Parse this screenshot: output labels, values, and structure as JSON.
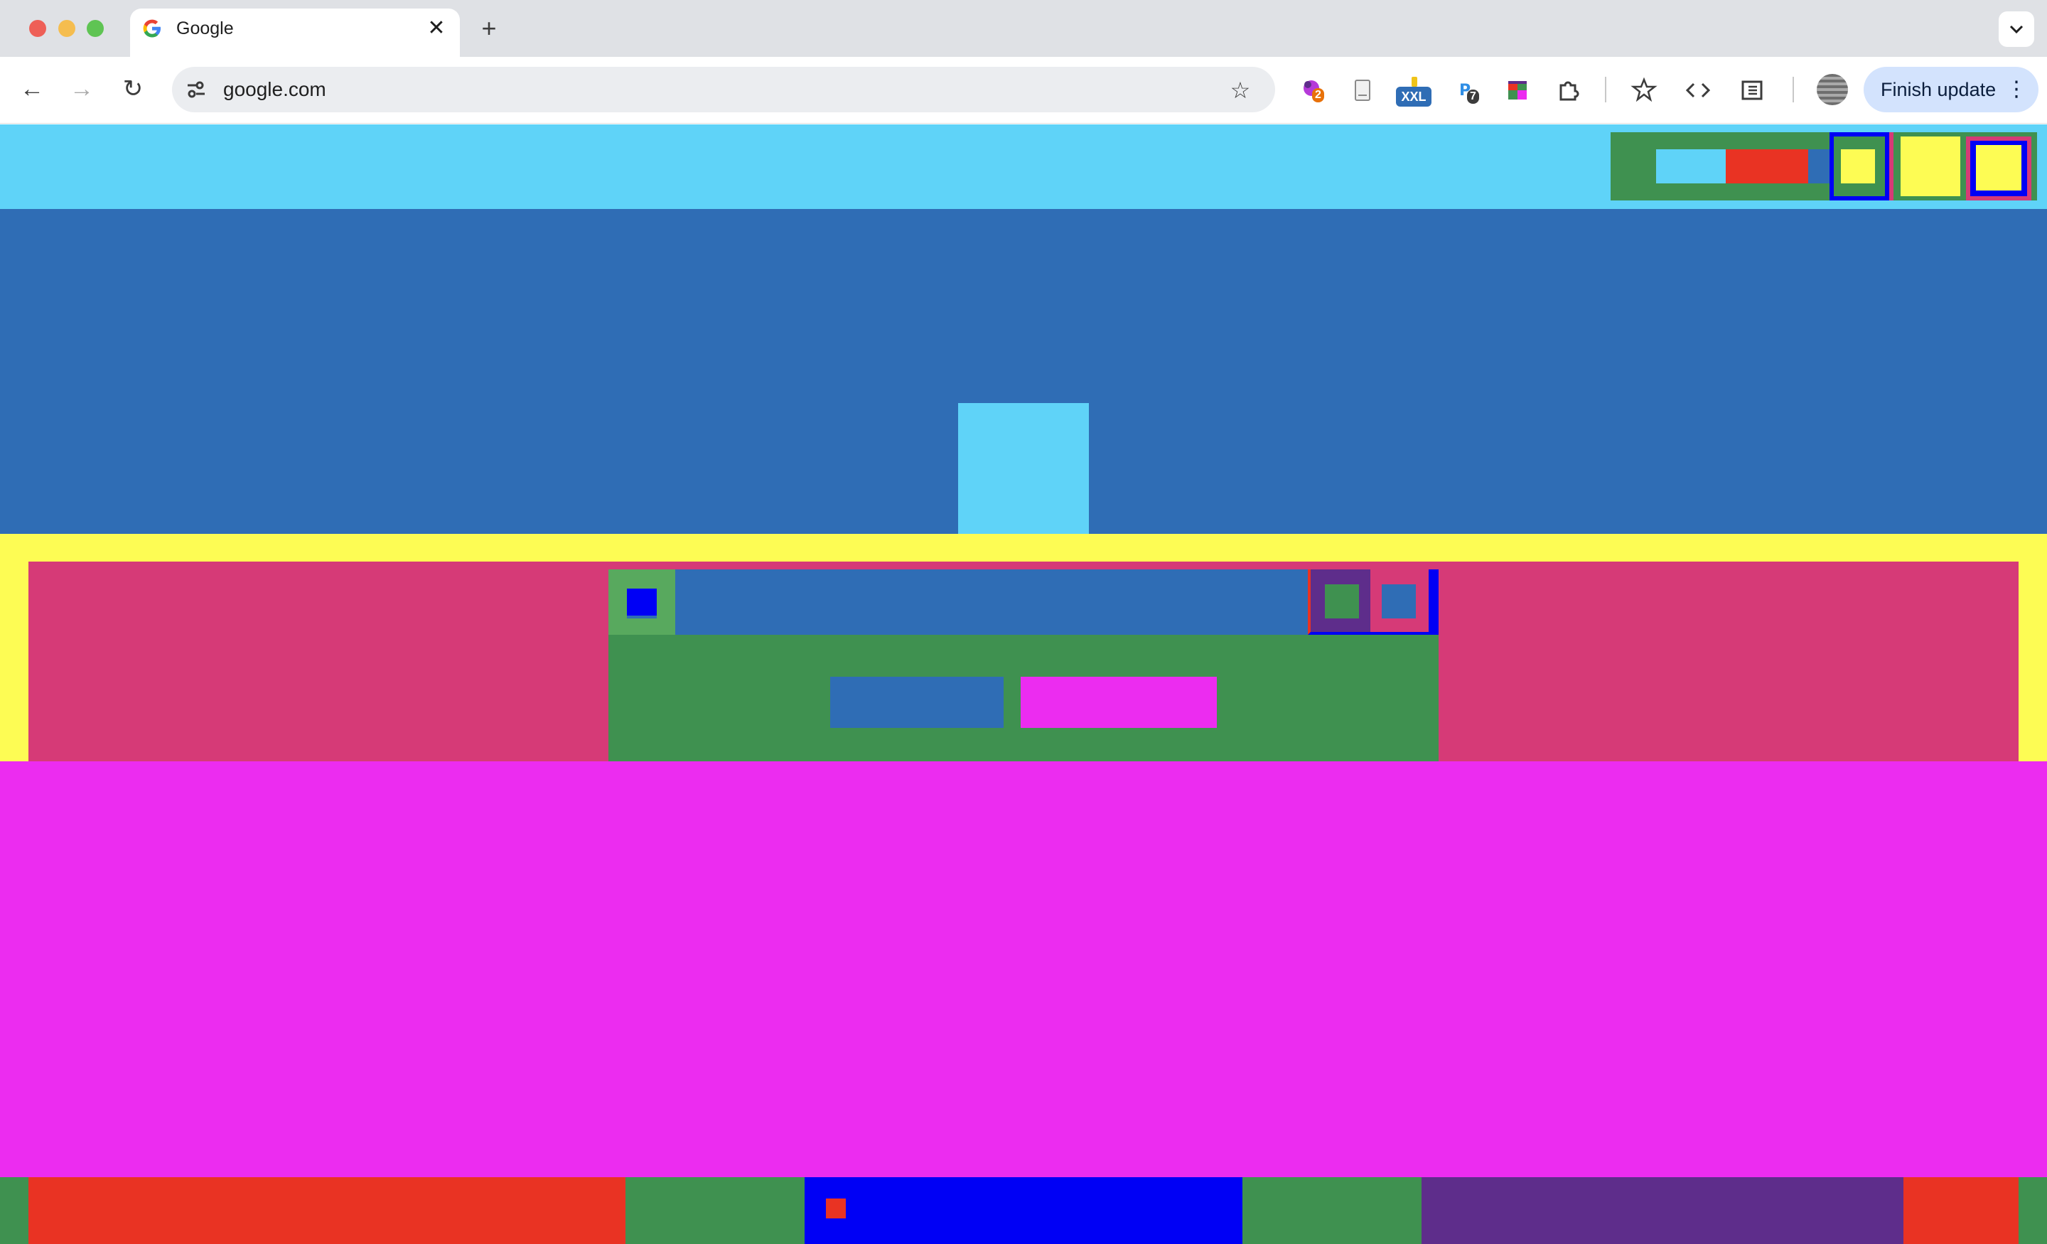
{
  "window": {
    "controls": [
      "close",
      "minimize",
      "zoom"
    ],
    "colors": {
      "close": "#ee5f57",
      "minimize": "#f5bd4f",
      "zoom": "#5fc453"
    }
  },
  "tab": {
    "title": "Google",
    "favicon": "google-g-icon",
    "close_glyph": "✕"
  },
  "new_tab_glyph": "+",
  "tab_search_glyph": "⌄",
  "toolbar": {
    "back_glyph": "←",
    "forward_glyph": "→",
    "reload_glyph": "↻",
    "site_info_glyph": "⚙",
    "url": "google.com",
    "bookmark_glyph": "☆",
    "extensions": [
      {
        "name": "ext-puzzle-purple-icon",
        "badge": "2"
      },
      {
        "name": "ext-document-icon",
        "badge": ""
      },
      {
        "name": "ext-xxl-icon",
        "label": "XXL"
      },
      {
        "name": "ext-p-icon",
        "badge": "7"
      },
      {
        "name": "ext-color-blocks-icon",
        "badge": ""
      },
      {
        "name": "extensions-puzzle-icon",
        "badge": ""
      }
    ],
    "reading_list_glyph": "✩",
    "devtools_glyph": "<>",
    "side_panel_glyph": "▤",
    "finish_update_label": "Finish update",
    "menu_glyph": "⋮"
  },
  "page_colors": {
    "cyan": "#5fd3f8",
    "blue": "#2f6db5",
    "yellow": "#fdfc54",
    "rose": "#d63a77",
    "green": "#3f9150",
    "magenta": "#ec2cf0",
    "red": "#e93323",
    "pure_blue": "#0000f5",
    "purple": "#5e2d8b"
  }
}
